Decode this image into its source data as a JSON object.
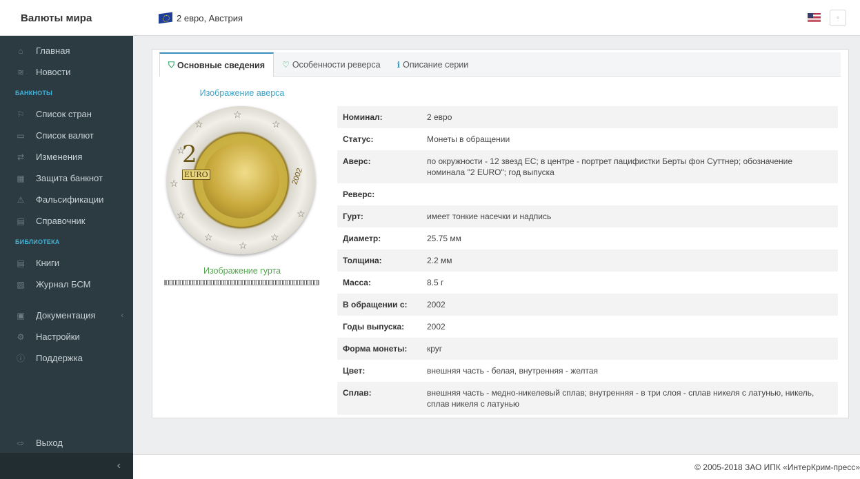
{
  "header": {
    "brand": "Валюты мира",
    "breadcrumb": "2 евро, Австрия",
    "settings_glyph": "◦"
  },
  "sidebar": {
    "items_top": [
      {
        "label": "Главная",
        "icon": "home-icon",
        "glyph": "⌂"
      },
      {
        "label": "Новости",
        "icon": "rss-icon",
        "glyph": "≋"
      }
    ],
    "section_banknotes": "БАНКНОТЫ",
    "items_banknotes": [
      {
        "label": "Список стран",
        "icon": "flag-icon",
        "glyph": "⚐"
      },
      {
        "label": "Список валют",
        "icon": "money-icon",
        "glyph": "▭"
      },
      {
        "label": "Изменения",
        "icon": "exchange-icon",
        "glyph": "⇄"
      },
      {
        "label": "Защита банкнот",
        "icon": "grid-icon",
        "glyph": "▦"
      },
      {
        "label": "Фальсификации",
        "icon": "warning-icon",
        "glyph": "⚠"
      },
      {
        "label": "Справочник",
        "icon": "file-icon",
        "glyph": "▤"
      }
    ],
    "section_library": "БИБЛИОТЕКА",
    "items_library": [
      {
        "label": "Книги",
        "icon": "book-icon",
        "glyph": "▤"
      },
      {
        "label": "Журнал БСМ",
        "icon": "journal-icon",
        "glyph": "▧"
      }
    ],
    "items_bottom": [
      {
        "label": "Документация",
        "icon": "archive-icon",
        "glyph": "▣",
        "arrow": "‹"
      },
      {
        "label": "Настройки",
        "icon": "gear-icon",
        "glyph": "⚙"
      },
      {
        "label": "Поддержка",
        "icon": "info-icon",
        "glyph": "ⓘ"
      }
    ],
    "logout": {
      "label": "Выход",
      "icon": "logout-icon",
      "glyph": "⇨"
    },
    "collapse_glyph": "‹"
  },
  "tabs": [
    {
      "label": "Основные сведения",
      "icon": "shield-icon",
      "glyph": "⛉",
      "active": true
    },
    {
      "label": "Особенности реверса",
      "icon": "shield-outline-icon",
      "glyph": "♡",
      "active": false
    },
    {
      "label": "Описание серии",
      "icon": "info-icon",
      "glyph": "ℹ",
      "active": false
    }
  ],
  "images": {
    "obverse_title": "Изображение аверса",
    "edge_title": "Изображение гурта",
    "coin_numeral": "2",
    "coin_euro_text": "EURO",
    "coin_year": "2002"
  },
  "details": [
    {
      "key": "Номинал:",
      "value": "2 евро"
    },
    {
      "key": "Статус:",
      "value": "Монеты в обращении"
    },
    {
      "key": "Аверс:",
      "value": "по окружности - 12 звезд ЕС; в центре - портрет пацифистки Берты фон Суттнер; обозначение номинала \"2 EURO\"; год выпуска"
    },
    {
      "key": "Реверс:",
      "value": ""
    },
    {
      "key": "Гурт:",
      "value": "имеет тонкие насечки и надпись"
    },
    {
      "key": "Диаметр:",
      "value": "25.75 мм"
    },
    {
      "key": "Толщина:",
      "value": "2.2 мм"
    },
    {
      "key": "Масса:",
      "value": "8.5 г"
    },
    {
      "key": "В обращении с:",
      "value": "2002"
    },
    {
      "key": "Годы выпуска:",
      "value": "2002"
    },
    {
      "key": "Форма монеты:",
      "value": "круг"
    },
    {
      "key": "Цвет:",
      "value": "внешняя часть - белая, внутренняя - желтая"
    },
    {
      "key": "Сплав:",
      "value": "внешняя часть - медно-никелевый сплав; внутренняя - в три слоя - сплав никеля с латунью, никель, сплав никеля с латунью"
    }
  ],
  "footer": {
    "copyright": "© 2005-2018 ЗАО ИПК «ИнтерКрим-пресс»"
  },
  "colors": {
    "sidebar_bg": "#2c3b41",
    "accent_blue": "#3c8dbc",
    "section_header": "#44b1d8",
    "obverse_title": "#3fa3c8",
    "edge_title": "#53a74e"
  }
}
